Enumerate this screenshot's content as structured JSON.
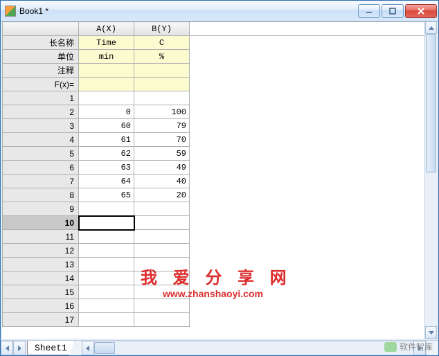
{
  "window": {
    "title": "Book1 *"
  },
  "columns": [
    {
      "key": "A",
      "label": "A(X)"
    },
    {
      "key": "B",
      "label": "B(Y)"
    }
  ],
  "meta_rows": [
    {
      "label": "长名称",
      "values": [
        "Time",
        "C"
      ]
    },
    {
      "label": "单位",
      "values": [
        "min",
        "%"
      ]
    },
    {
      "label": "注释",
      "values": [
        "",
        ""
      ]
    },
    {
      "label": "F(x)=",
      "values": [
        "",
        ""
      ]
    }
  ],
  "data_rows": [
    {
      "n": 1,
      "values": [
        "",
        ""
      ]
    },
    {
      "n": 2,
      "values": [
        "0",
        "100"
      ]
    },
    {
      "n": 3,
      "values": [
        "60",
        "79"
      ]
    },
    {
      "n": 4,
      "values": [
        "61",
        "70"
      ]
    },
    {
      "n": 5,
      "values": [
        "62",
        "59"
      ]
    },
    {
      "n": 6,
      "values": [
        "63",
        "49"
      ]
    },
    {
      "n": 7,
      "values": [
        "64",
        "40"
      ]
    },
    {
      "n": 8,
      "values": [
        "65",
        "20"
      ]
    },
    {
      "n": 9,
      "values": [
        "",
        ""
      ]
    },
    {
      "n": 10,
      "values": [
        "",
        ""
      ],
      "selected": true
    },
    {
      "n": 11,
      "values": [
        "",
        ""
      ]
    },
    {
      "n": 12,
      "values": [
        "",
        ""
      ]
    },
    {
      "n": 13,
      "values": [
        "",
        ""
      ]
    },
    {
      "n": 14,
      "values": [
        "",
        ""
      ]
    },
    {
      "n": 15,
      "values": [
        "",
        ""
      ]
    },
    {
      "n": 16,
      "values": [
        "",
        ""
      ]
    },
    {
      "n": 17,
      "values": [
        "",
        ""
      ]
    }
  ],
  "sheet_tab": "Sheet1",
  "watermark": {
    "line1": "我 爱 分 享 网",
    "line2": "www.zhanshaoyi.com"
  },
  "brand": "软件智库"
}
